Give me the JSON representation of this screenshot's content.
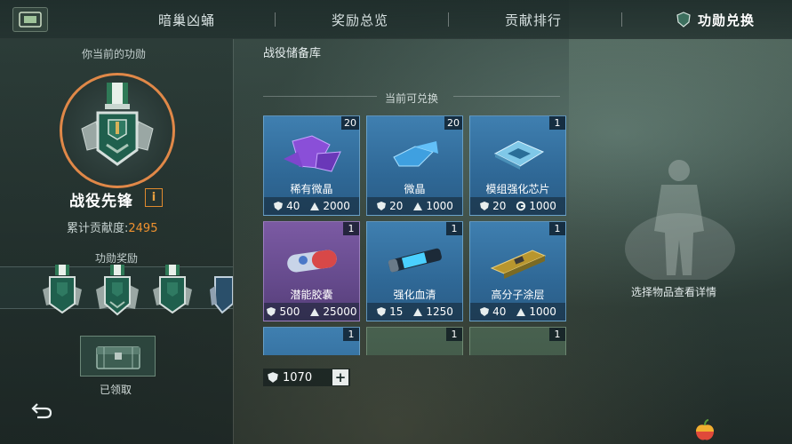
{
  "tabs": [
    {
      "label": "暗巢凶蛹",
      "active": false
    },
    {
      "label": "奖励总览",
      "active": false
    },
    {
      "label": "贡献排行",
      "active": false
    },
    {
      "label": "功勋兑换",
      "active": true
    }
  ],
  "left": {
    "current_merit_label": "你当前的功勋",
    "rank_name": "战役先锋",
    "info_icon": "info-icon",
    "contribution_label": "累计贡献度:",
    "contribution_value": "2495",
    "merit_rewards_label": "功勋奖励",
    "claimed_label": "已领取"
  },
  "center": {
    "section_title": "战役储备库",
    "available_label": "当前可兑换",
    "items": [
      {
        "name": "稀有微晶",
        "count": "20",
        "cost_merit": "40",
        "cost_secondary": "2000",
        "secondary_icon": "credit-icon",
        "rarity": "blue"
      },
      {
        "name": "微晶",
        "count": "20",
        "cost_merit": "20",
        "cost_secondary": "1000",
        "secondary_icon": "credit-icon",
        "rarity": "blue"
      },
      {
        "name": "模组强化芯片",
        "count": "1",
        "cost_merit": "20",
        "cost_secondary": "1000",
        "secondary_icon": "gear-icon",
        "rarity": "blue"
      },
      {
        "name": "潜能胶囊",
        "count": "1",
        "cost_merit": "500",
        "cost_secondary": "25000",
        "secondary_icon": "credit-icon",
        "rarity": "purple"
      },
      {
        "name": "强化血清",
        "count": "1",
        "cost_merit": "15",
        "cost_secondary": "1250",
        "secondary_icon": "credit-icon",
        "rarity": "blue"
      },
      {
        "name": "高分子涂层",
        "count": "1",
        "cost_merit": "40",
        "cost_secondary": "1000",
        "secondary_icon": "credit-icon",
        "rarity": "blue"
      },
      {
        "name": "",
        "count": "1",
        "cost_merit": "",
        "cost_secondary": "",
        "secondary_icon": "",
        "rarity": "blue"
      },
      {
        "name": "",
        "count": "1",
        "cost_merit": "",
        "cost_secondary": "",
        "secondary_icon": "",
        "rarity": "green"
      },
      {
        "name": "",
        "count": "1",
        "cost_merit": "",
        "cost_secondary": "",
        "secondary_icon": "",
        "rarity": "green"
      }
    ],
    "merit_balance": "1070",
    "plus_label": "+"
  },
  "right": {
    "detail_hint": "选择物品查看详情"
  },
  "colors": {
    "accent_orange": "#e08848",
    "contribution_orange": "#f0922f",
    "card_blue": "#3f7fb0",
    "card_purple": "#7b5aa3"
  }
}
